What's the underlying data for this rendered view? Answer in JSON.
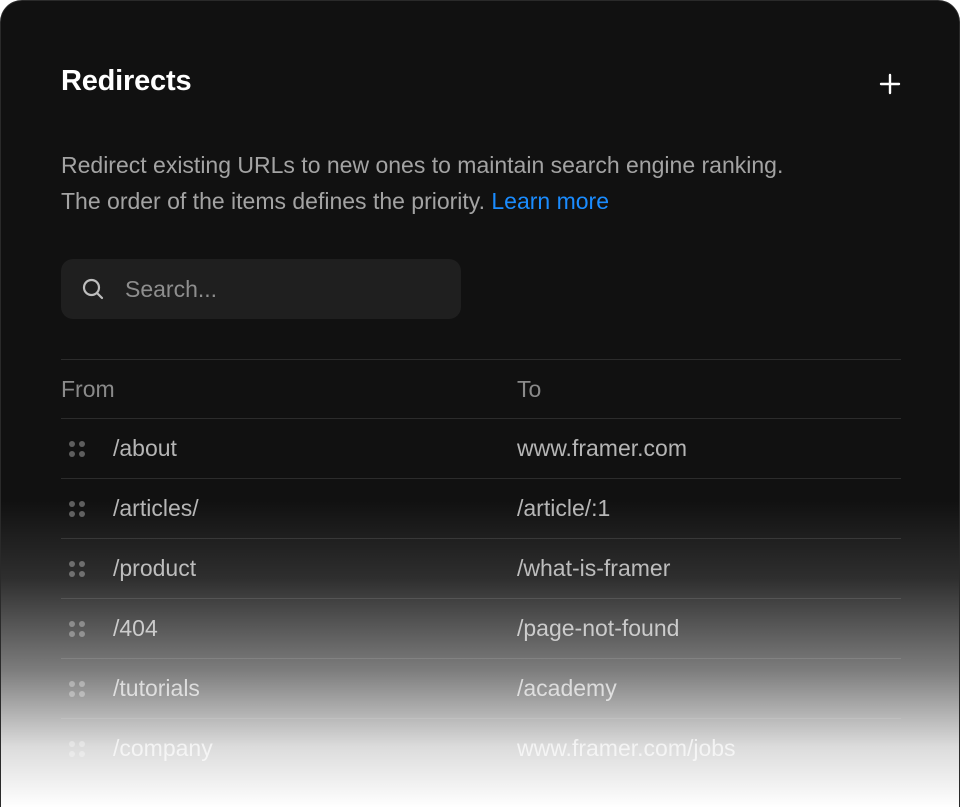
{
  "panel": {
    "title": "Redirects",
    "description": "Redirect existing URLs to new ones to maintain search engine ranking. The order of the items defines the priority.",
    "learn_more": "Learn more",
    "add_icon": "plus-icon"
  },
  "search": {
    "icon": "search-icon",
    "placeholder": "Search..."
  },
  "table": {
    "columns": [
      "From",
      "To"
    ],
    "drag_icon": "drag-handle-icon",
    "rows": [
      {
        "from": "/about",
        "to": "www.framer.com"
      },
      {
        "from": "/articles/",
        "to": "/article/:1"
      },
      {
        "from": "/product",
        "to": "/what-is-framer"
      },
      {
        "from": "/404",
        "to": "/page-not-found"
      },
      {
        "from": "/tutorials",
        "to": "/academy"
      },
      {
        "from": "/company",
        "to": "www.framer.com/jobs"
      }
    ]
  },
  "colors": {
    "panel_bg": "#111111",
    "text_primary": "#ffffff",
    "text_secondary": "#a3a3a3",
    "link": "#1a8cff",
    "search_bg": "#1f1f1f",
    "divider": "#2c2c2c"
  }
}
